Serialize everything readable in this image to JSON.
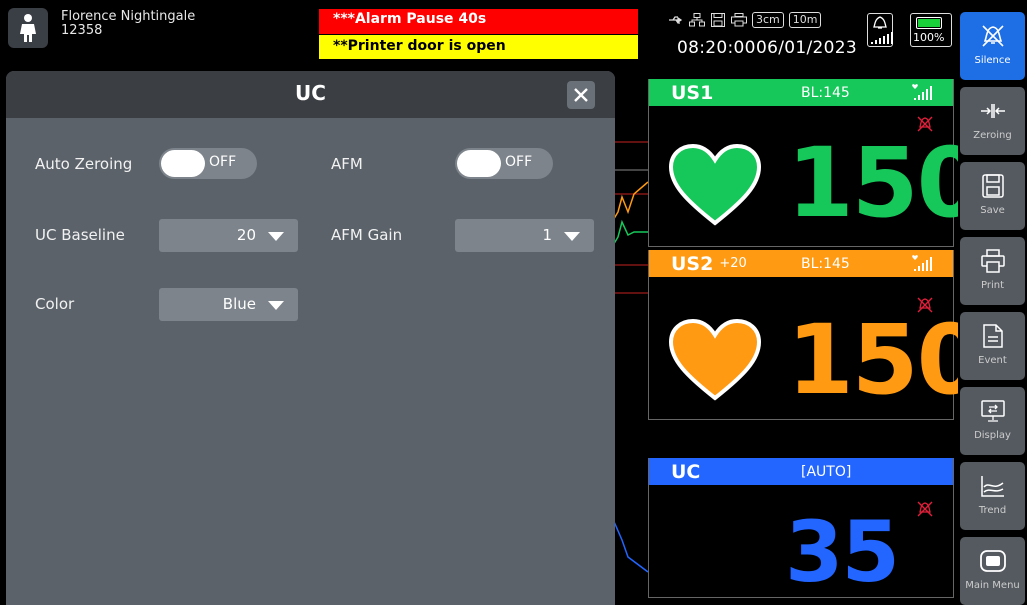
{
  "patient": {
    "name": "Florence Nightingale",
    "id": "12358"
  },
  "alarms": {
    "high": "***Alarm Pause 40s",
    "low": "**Printer door is open"
  },
  "status": {
    "scale": "3cm",
    "interval": "10m",
    "time": "08:20:00",
    "date": "06/01/2023",
    "battery": "100%",
    "battery_level": 1.0
  },
  "colors": {
    "us1": "#16c85a",
    "us2": "#ff9a12",
    "uc": "#2265ff",
    "alarm_red": "#ff0000",
    "alarm_yellow": "#ffff00",
    "active": "#1e6fe6"
  },
  "dialog": {
    "title": "UC",
    "auto_zeroing": {
      "label": "Auto Zeroing",
      "value": "OFF"
    },
    "afm": {
      "label": "AFM",
      "value": "OFF"
    },
    "uc_baseline": {
      "label": "UC Baseline",
      "value": "20"
    },
    "afm_gain": {
      "label": "AFM Gain",
      "value": "1"
    },
    "color": {
      "label": "Color",
      "value": "Blue"
    }
  },
  "us1": {
    "label": "US1",
    "bl": "BL:145",
    "value": "150"
  },
  "us2": {
    "label": "US2",
    "offset": "+20",
    "bl": "BL:145",
    "value": "150"
  },
  "uc": {
    "label": "UC",
    "mode": "[AUTO]",
    "value": "35"
  },
  "sidebar": {
    "silence": "Silence",
    "zeroing": "Zeroing",
    "save": "Save",
    "print": "Print",
    "event": "Event",
    "display": "Display",
    "trend": "Trend",
    "main_menu": "Main Menu"
  }
}
